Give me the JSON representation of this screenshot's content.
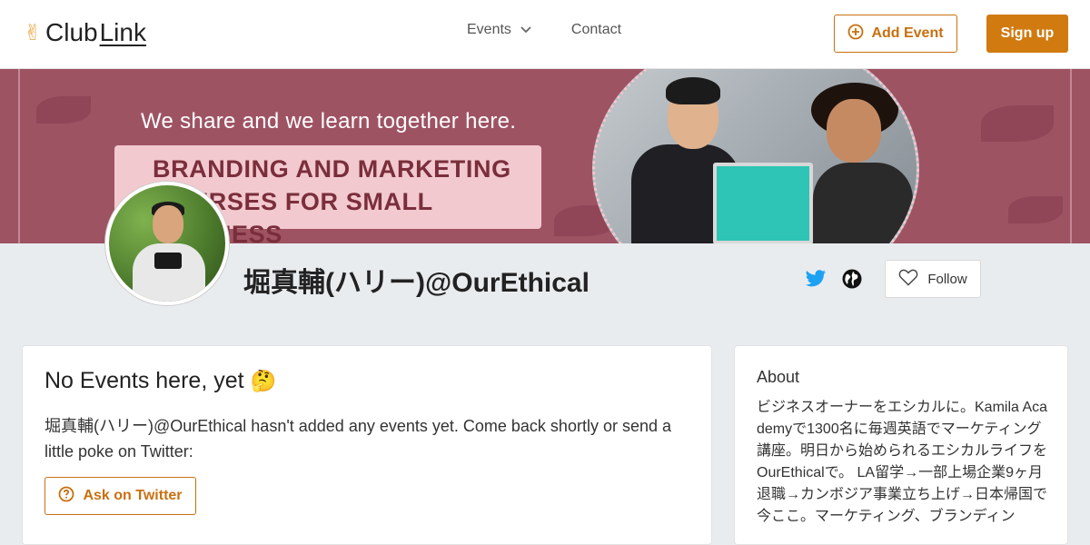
{
  "header": {
    "logo_prefix": "Club",
    "logo_suffix": "Link",
    "nav": {
      "events_label": "Events",
      "contact_label": "Contact"
    },
    "add_event_label": "Add Event",
    "signup_label": "Sign up"
  },
  "banner": {
    "tagline": "We share and we learn together here.",
    "box_text": "BRANDING AND MARKETING COURSES FOR SMALL BUSINESS"
  },
  "profile": {
    "name": "堀真輔(ハリー)@OurEthical",
    "follow_label": "Follow"
  },
  "events_card": {
    "title": "No Events here, yet",
    "title_emoji": "🤔",
    "message": "堀真輔(ハリー)@OurEthical hasn't added any events yet. Come back shortly or send a little poke on Twitter:",
    "ask_label": "Ask on Twitter"
  },
  "about": {
    "title": "About",
    "text": "ビジネスオーナーをエシカルに。Kamila Academyで1300名に毎週英語でマーケティング講座。明日から始められるエシカルライフをOurEthicalで。 LA留学→一部上場企業9ヶ月退職→カンボジア事業立ち上げ→日本帰国で今ここ。マーケティング、ブランディン"
  },
  "colors": {
    "accent": "#d07a10",
    "twitter": "#1da1f2",
    "banner": "#9e5363"
  },
  "icons": {
    "logo": "victory-hand-icon",
    "events_dropdown": "chevron-down-icon",
    "add_event": "plus-circle-icon",
    "twitter": "twitter-icon",
    "website": "globe-icon",
    "follow": "heart-icon",
    "ask": "question-circle-icon"
  }
}
